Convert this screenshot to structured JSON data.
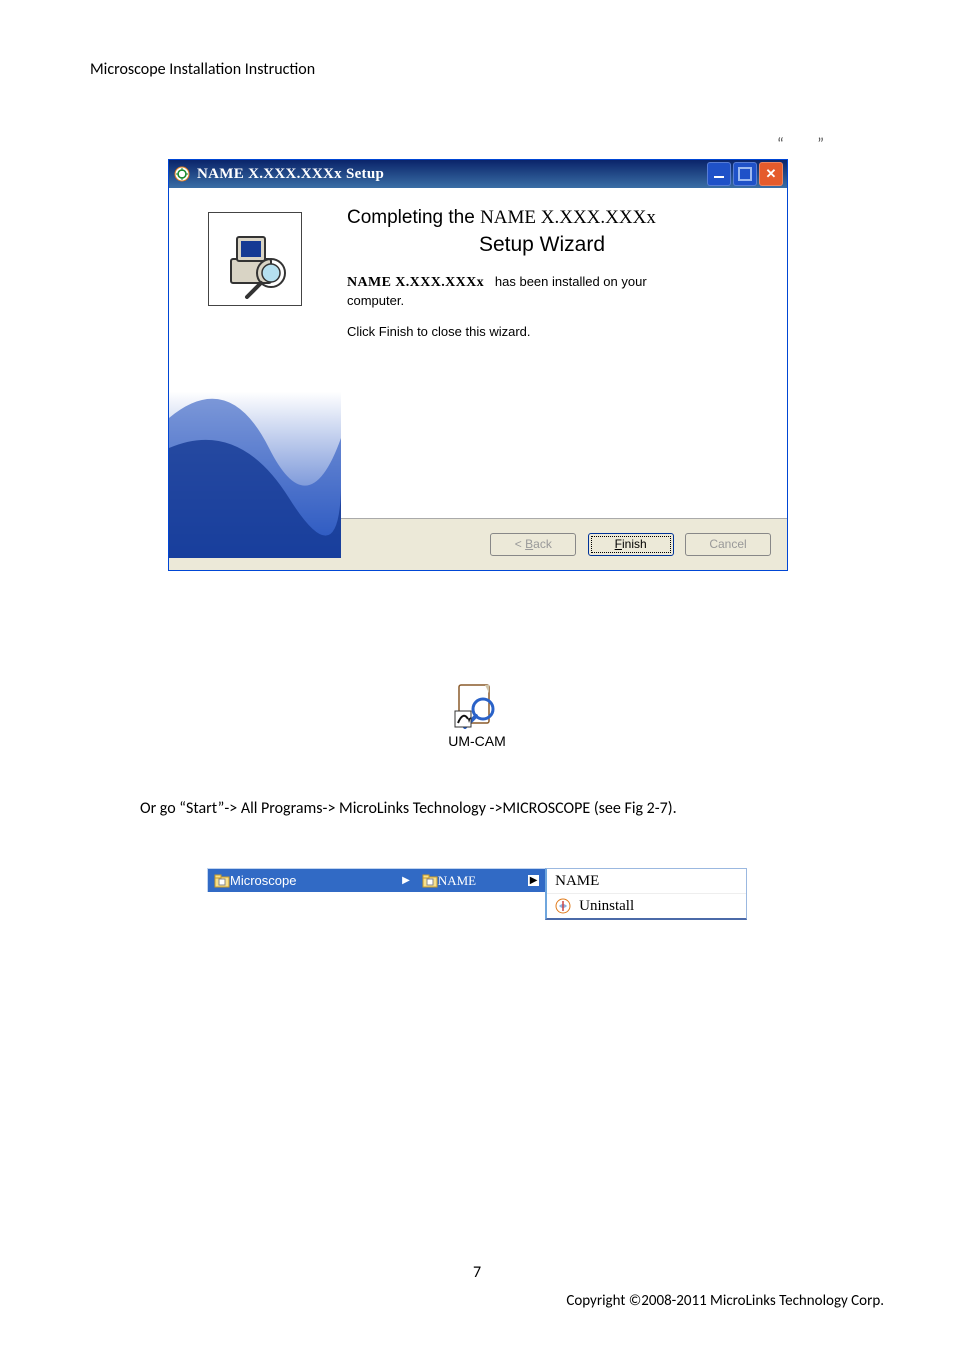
{
  "header": "Microscope Installation Instruction",
  "quotes": {
    "open": "“",
    "close": "”"
  },
  "dialog": {
    "title": "NAME X.XXX.XXXx  Setup",
    "heading_prefix": "Completing the",
    "heading_product": "NAME X.XXX.XXXx",
    "heading_line2": "Setup Wizard",
    "line1_product": "NAME X.XXX.XXXx",
    "line1_rest": "has been installed on your",
    "line1_end": "computer.",
    "line2": "Click Finish to close this wizard.",
    "buttons": {
      "back_prefix": "< ",
      "back_ul": "B",
      "back_rest": "ack",
      "finish_ul": "F",
      "finish_rest": "inish",
      "cancel": "Cancel"
    }
  },
  "desktop_icon_label": "UM-CAM",
  "paragraph": "Or go “Start”-> All Programs-> MicroLinks Technology ->MICROSCOPE (see Fig 2-7).",
  "startmenu": {
    "col1": "Microscope",
    "col2": "NAME",
    "col3a": "NAME",
    "col3b": "Uninstall"
  },
  "footer": {
    "page": "7",
    "copyright": "Copyright ©2008-2011 MicroLinks Technology Corp."
  }
}
